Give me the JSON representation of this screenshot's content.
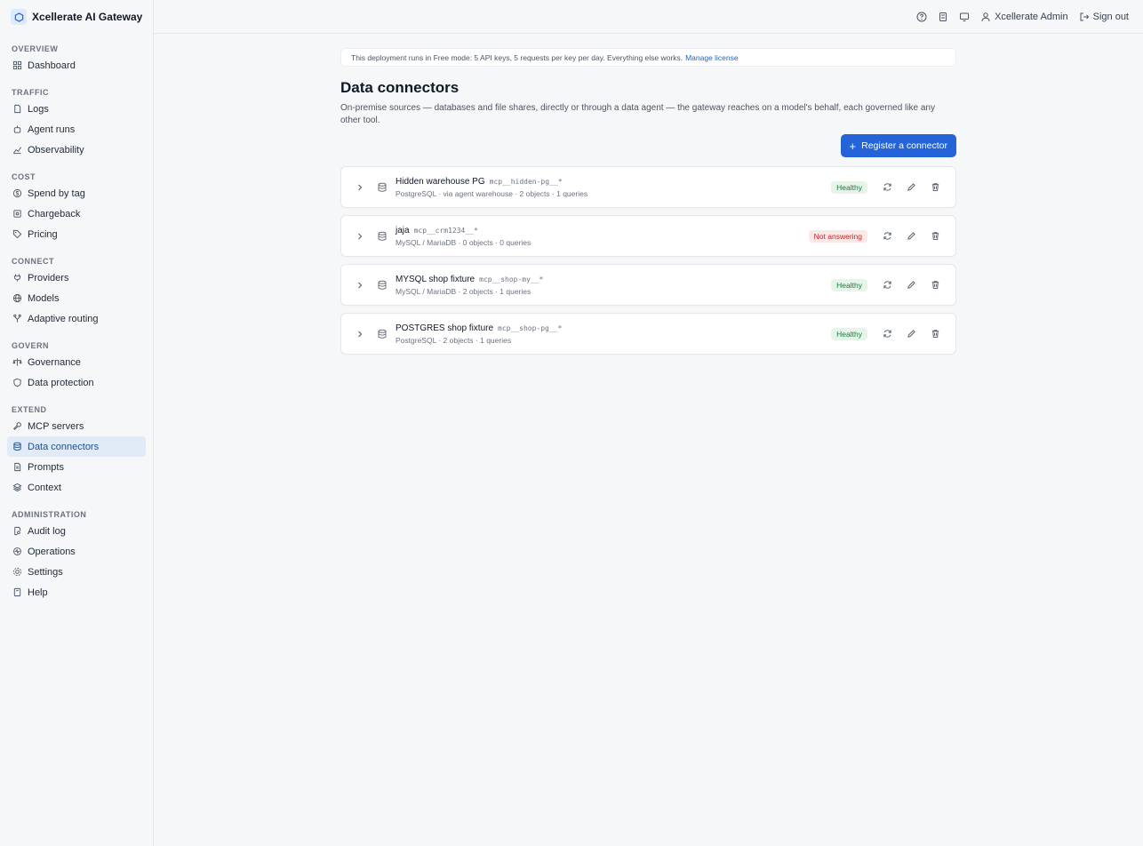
{
  "app": {
    "name": "Xcellerate AI Gateway"
  },
  "sidebar": {
    "sections": [
      {
        "title": "OVERVIEW",
        "items": [
          {
            "label": "Dashboard",
            "icon": "grid-icon"
          }
        ]
      },
      {
        "title": "TRAFFIC",
        "items": [
          {
            "label": "Logs",
            "icon": "document-icon"
          },
          {
            "label": "Agent runs",
            "icon": "robot-icon"
          },
          {
            "label": "Observability",
            "icon": "line-chart-icon"
          }
        ]
      },
      {
        "title": "COST",
        "items": [
          {
            "label": "Spend by tag",
            "icon": "dollar-icon"
          },
          {
            "label": "Chargeback",
            "icon": "receipt-icon"
          },
          {
            "label": "Pricing",
            "icon": "tag-icon"
          }
        ]
      },
      {
        "title": "CONNECT",
        "items": [
          {
            "label": "Providers",
            "icon": "plug-icon"
          },
          {
            "label": "Models",
            "icon": "globe-icon"
          },
          {
            "label": "Adaptive routing",
            "icon": "branch-icon"
          }
        ]
      },
      {
        "title": "GOVERN",
        "items": [
          {
            "label": "Governance",
            "icon": "scale-icon"
          },
          {
            "label": "Data protection",
            "icon": "shield-icon"
          }
        ]
      },
      {
        "title": "EXTEND",
        "items": [
          {
            "label": "MCP servers",
            "icon": "wrench-icon"
          },
          {
            "label": "Data connectors",
            "icon": "database-icon",
            "active": true
          },
          {
            "label": "Prompts",
            "icon": "file-icon"
          },
          {
            "label": "Context",
            "icon": "layers-icon"
          }
        ]
      },
      {
        "title": "ADMINISTRATION",
        "items": [
          {
            "label": "Audit log",
            "icon": "search-doc-icon"
          },
          {
            "label": "Operations",
            "icon": "cog-pulse-icon"
          },
          {
            "label": "Settings",
            "icon": "gear-icon"
          },
          {
            "label": "Help",
            "icon": "book-icon"
          }
        ]
      }
    ]
  },
  "topbar": {
    "user": "Xcellerate Admin",
    "signout": "Sign out"
  },
  "banner": {
    "text": "This deployment runs in Free mode: 5 API keys, 5 requests per key per day. Everything else works.",
    "link": "Manage license"
  },
  "page": {
    "title": "Data connectors",
    "description": "On-premise sources — databases and file shares, directly or through a data agent — the gateway reaches on a model's behalf, each governed like any other tool.",
    "register_label": "Register a connector"
  },
  "connectors": [
    {
      "name": "Hidden warehouse PG",
      "ns": "mcp__hidden-pg__*",
      "meta": "PostgreSQL · via agent warehouse · 2 objects · 1 queries",
      "status": "Healthy",
      "ok": true
    },
    {
      "name": "jaja",
      "ns": "mcp__crm1234__*",
      "meta": "MySQL / MariaDB · 0 objects · 0 queries",
      "status": "Not answering",
      "ok": false
    },
    {
      "name": "MYSQL shop fixture",
      "ns": "mcp__shop-my__*",
      "meta": "MySQL / MariaDB · 2 objects · 1 queries",
      "status": "Healthy",
      "ok": true
    },
    {
      "name": "POSTGRES shop fixture",
      "ns": "mcp__shop-pg__*",
      "meta": "PostgreSQL · 2 objects · 1 queries",
      "status": "Healthy",
      "ok": true
    }
  ]
}
